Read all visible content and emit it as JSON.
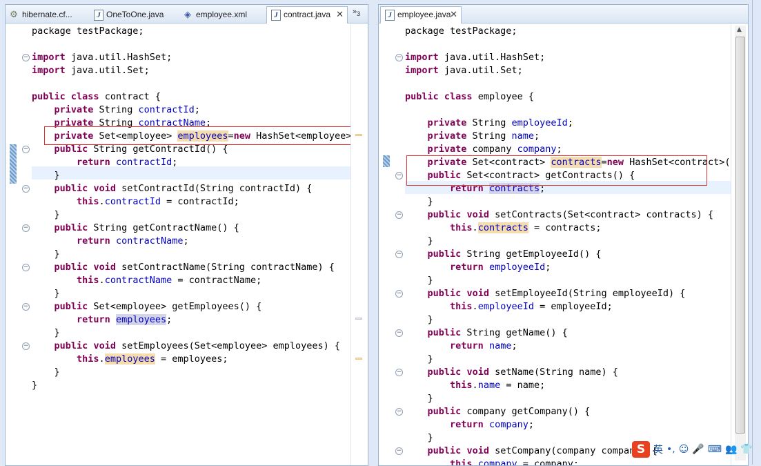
{
  "left_editor": {
    "tabs": [
      {
        "label": "hibernate.cf...",
        "icon": "hibernate-config-icon",
        "active": false
      },
      {
        "label": "OneToOne.java",
        "icon": "java-file-icon",
        "active": false
      },
      {
        "label": "employee.xml",
        "icon": "xml-file-icon",
        "active": false
      },
      {
        "label": "contract.java",
        "icon": "java-file-icon",
        "active": true
      }
    ],
    "close_glyph": "✕",
    "overflow_label": "»",
    "overflow_count": "3",
    "code": [
      [
        [
          "t",
          "package testPackage;"
        ]
      ],
      [],
      [
        [
          "k",
          "import"
        ],
        [
          "t",
          " java.util.HashSet;"
        ]
      ],
      [
        [
          "k",
          "import"
        ],
        [
          "t",
          " java.util.Set;"
        ]
      ],
      [],
      [
        [
          "k",
          "public"
        ],
        [
          "t",
          " "
        ],
        [
          "k",
          "class"
        ],
        [
          "t",
          " contract {"
        ]
      ],
      [
        [
          "t",
          "    "
        ],
        [
          "k",
          "private"
        ],
        [
          "t",
          " String "
        ],
        [
          "f",
          "contractId"
        ],
        [
          "t",
          ";"
        ]
      ],
      [
        [
          "t",
          "    "
        ],
        [
          "k",
          "private"
        ],
        [
          "t",
          " String "
        ],
        [
          "f",
          "contractName"
        ],
        [
          "t",
          ";"
        ]
      ],
      [
        [
          "t",
          "    "
        ],
        [
          "k",
          "private"
        ],
        [
          "t",
          " Set<employee> "
        ],
        [
          "h",
          "employees"
        ],
        [
          "t",
          "="
        ],
        [
          "k",
          "new"
        ],
        [
          "t",
          " HashSet<employee>();"
        ]
      ],
      [
        [
          "t",
          "    "
        ],
        [
          "k",
          "public"
        ],
        [
          "t",
          " String getContractId() {"
        ]
      ],
      [
        [
          "t",
          "        "
        ],
        [
          "k",
          "return"
        ],
        [
          "t",
          " "
        ],
        [
          "f",
          "contractId"
        ],
        [
          "t",
          ";"
        ]
      ],
      [
        [
          "t",
          "    }"
        ]
      ],
      [
        [
          "t",
          "    "
        ],
        [
          "k",
          "public"
        ],
        [
          "t",
          " "
        ],
        [
          "k",
          "void"
        ],
        [
          "t",
          " setContractId(String contractId) {"
        ]
      ],
      [
        [
          "t",
          "        "
        ],
        [
          "k",
          "this"
        ],
        [
          "t",
          "."
        ],
        [
          "f",
          "contractId"
        ],
        [
          "t",
          " = contractId;"
        ]
      ],
      [
        [
          "t",
          "    }"
        ]
      ],
      [
        [
          "t",
          "    "
        ],
        [
          "k",
          "public"
        ],
        [
          "t",
          " String getContractName() {"
        ]
      ],
      [
        [
          "t",
          "        "
        ],
        [
          "k",
          "return"
        ],
        [
          "t",
          " "
        ],
        [
          "f",
          "contractName"
        ],
        [
          "t",
          ";"
        ]
      ],
      [
        [
          "t",
          "    }"
        ]
      ],
      [
        [
          "t",
          "    "
        ],
        [
          "k",
          "public"
        ],
        [
          "t",
          " "
        ],
        [
          "k",
          "void"
        ],
        [
          "t",
          " setContractName(String contractName) {"
        ]
      ],
      [
        [
          "t",
          "        "
        ],
        [
          "k",
          "this"
        ],
        [
          "t",
          "."
        ],
        [
          "f",
          "contractName"
        ],
        [
          "t",
          " = contractName;"
        ]
      ],
      [
        [
          "t",
          "    }"
        ]
      ],
      [
        [
          "t",
          "    "
        ],
        [
          "k",
          "public"
        ],
        [
          "t",
          " Set<employee> getEmployees() {"
        ]
      ],
      [
        [
          "t",
          "        "
        ],
        [
          "k",
          "return"
        ],
        [
          "t",
          " "
        ],
        [
          "r",
          "employees"
        ],
        [
          "t",
          ";"
        ]
      ],
      [
        [
          "t",
          "    }"
        ]
      ],
      [
        [
          "t",
          "    "
        ],
        [
          "k",
          "public"
        ],
        [
          "t",
          " "
        ],
        [
          "k",
          "void"
        ],
        [
          "t",
          " setEmployees(Set<employee> employees) {"
        ]
      ],
      [
        [
          "t",
          "        "
        ],
        [
          "k",
          "this"
        ],
        [
          "t",
          "."
        ],
        [
          "h",
          "employees"
        ],
        [
          "t",
          " = employees;"
        ]
      ],
      [
        [
          "t",
          "    }"
        ]
      ],
      [
        [
          "t",
          "}"
        ]
      ]
    ]
  },
  "right_editor": {
    "tabs": [
      {
        "label": "employee.java",
        "icon": "java-file-icon",
        "active": true
      }
    ],
    "close_glyph": "✕",
    "code": [
      [
        [
          "t",
          "package testPackage;"
        ]
      ],
      [],
      [
        [
          "k",
          "import"
        ],
        [
          "t",
          " java.util.HashSet;"
        ]
      ],
      [
        [
          "k",
          "import"
        ],
        [
          "t",
          " java.util.Set;"
        ]
      ],
      [],
      [
        [
          "k",
          "public"
        ],
        [
          "t",
          " "
        ],
        [
          "k",
          "class"
        ],
        [
          "t",
          " employee {"
        ]
      ],
      [],
      [
        [
          "t",
          "    "
        ],
        [
          "k",
          "private"
        ],
        [
          "t",
          " String "
        ],
        [
          "f",
          "employeeId"
        ],
        [
          "t",
          ";"
        ]
      ],
      [
        [
          "t",
          "    "
        ],
        [
          "k",
          "private"
        ],
        [
          "t",
          " String "
        ],
        [
          "f",
          "name"
        ],
        [
          "t",
          ";"
        ]
      ],
      [
        [
          "t",
          "    "
        ],
        [
          "k",
          "private"
        ],
        [
          "t",
          " company "
        ],
        [
          "f",
          "company"
        ],
        [
          "t",
          ";"
        ]
      ],
      [
        [
          "t",
          "    "
        ],
        [
          "k",
          "private"
        ],
        [
          "t",
          " Set<contract> "
        ],
        [
          "h",
          "contracts"
        ],
        [
          "t",
          "="
        ],
        [
          "k",
          "new"
        ],
        [
          "t",
          " HashSet<contract>();"
        ]
      ],
      [
        [
          "t",
          "    "
        ],
        [
          "k",
          "public"
        ],
        [
          "t",
          " Set<contract> getContracts() {"
        ]
      ],
      [
        [
          "t",
          "        "
        ],
        [
          "k",
          "return"
        ],
        [
          "t",
          " "
        ],
        [
          "r",
          "contracts"
        ],
        [
          "t",
          ";"
        ]
      ],
      [
        [
          "t",
          "    }"
        ]
      ],
      [
        [
          "t",
          "    "
        ],
        [
          "k",
          "public"
        ],
        [
          "t",
          " "
        ],
        [
          "k",
          "void"
        ],
        [
          "t",
          " setContracts(Set<contract> contracts) {"
        ]
      ],
      [
        [
          "t",
          "        "
        ],
        [
          "k",
          "this"
        ],
        [
          "t",
          "."
        ],
        [
          "h",
          "contracts"
        ],
        [
          "t",
          " = contracts;"
        ]
      ],
      [
        [
          "t",
          "    }"
        ]
      ],
      [
        [
          "t",
          "    "
        ],
        [
          "k",
          "public"
        ],
        [
          "t",
          " String getEmployeeId() {"
        ]
      ],
      [
        [
          "t",
          "        "
        ],
        [
          "k",
          "return"
        ],
        [
          "t",
          " "
        ],
        [
          "f",
          "employeeId"
        ],
        [
          "t",
          ";"
        ]
      ],
      [
        [
          "t",
          "    }"
        ]
      ],
      [
        [
          "t",
          "    "
        ],
        [
          "k",
          "public"
        ],
        [
          "t",
          " "
        ],
        [
          "k",
          "void"
        ],
        [
          "t",
          " setEmployeeId(String employeeId) {"
        ]
      ],
      [
        [
          "t",
          "        "
        ],
        [
          "k",
          "this"
        ],
        [
          "t",
          "."
        ],
        [
          "f",
          "employeeId"
        ],
        [
          "t",
          " = employeeId;"
        ]
      ],
      [
        [
          "t",
          "    }"
        ]
      ],
      [
        [
          "t",
          "    "
        ],
        [
          "k",
          "public"
        ],
        [
          "t",
          " String getName() {"
        ]
      ],
      [
        [
          "t",
          "        "
        ],
        [
          "k",
          "return"
        ],
        [
          "t",
          " "
        ],
        [
          "f",
          "name"
        ],
        [
          "t",
          ";"
        ]
      ],
      [
        [
          "t",
          "    }"
        ]
      ],
      [
        [
          "t",
          "    "
        ],
        [
          "k",
          "public"
        ],
        [
          "t",
          " "
        ],
        [
          "k",
          "void"
        ],
        [
          "t",
          " setName(String name) {"
        ]
      ],
      [
        [
          "t",
          "        "
        ],
        [
          "k",
          "this"
        ],
        [
          "t",
          "."
        ],
        [
          "f",
          "name"
        ],
        [
          "t",
          " = name;"
        ]
      ],
      [
        [
          "t",
          "    }"
        ]
      ],
      [
        [
          "t",
          "    "
        ],
        [
          "k",
          "public"
        ],
        [
          "t",
          " company getCompany() {"
        ]
      ],
      [
        [
          "t",
          "        "
        ],
        [
          "k",
          "return"
        ],
        [
          "t",
          " "
        ],
        [
          "f",
          "company"
        ],
        [
          "t",
          ";"
        ]
      ],
      [
        [
          "t",
          "    }"
        ]
      ],
      [
        [
          "t",
          "    "
        ],
        [
          "k",
          "public"
        ],
        [
          "t",
          " "
        ],
        [
          "k",
          "void"
        ],
        [
          "t",
          " setCompany(company company) {"
        ]
      ],
      [
        [
          "t",
          "        "
        ],
        [
          "k",
          "this"
        ],
        [
          "t",
          "."
        ],
        [
          "f",
          "company"
        ],
        [
          "t",
          " = company;"
        ]
      ]
    ]
  },
  "colors": {
    "keyword": "#7f0055",
    "field": "#0000c0",
    "occurrence": "#f5dcae",
    "annotation_box": "#e03030"
  },
  "ime_toolbar": {
    "logo": "S",
    "lang": "英",
    "items": [
      {
        "glyph": "•,",
        "icon": "punctuation-icon"
      },
      {
        "glyph": "☺",
        "icon": "emoji-icon"
      },
      {
        "glyph": "🎤",
        "icon": "microphone-icon"
      },
      {
        "glyph": "⌨",
        "icon": "keyboard-icon"
      },
      {
        "glyph": "👥",
        "icon": "user-icon"
      },
      {
        "glyph": "👕",
        "icon": "skin-icon"
      }
    ]
  }
}
